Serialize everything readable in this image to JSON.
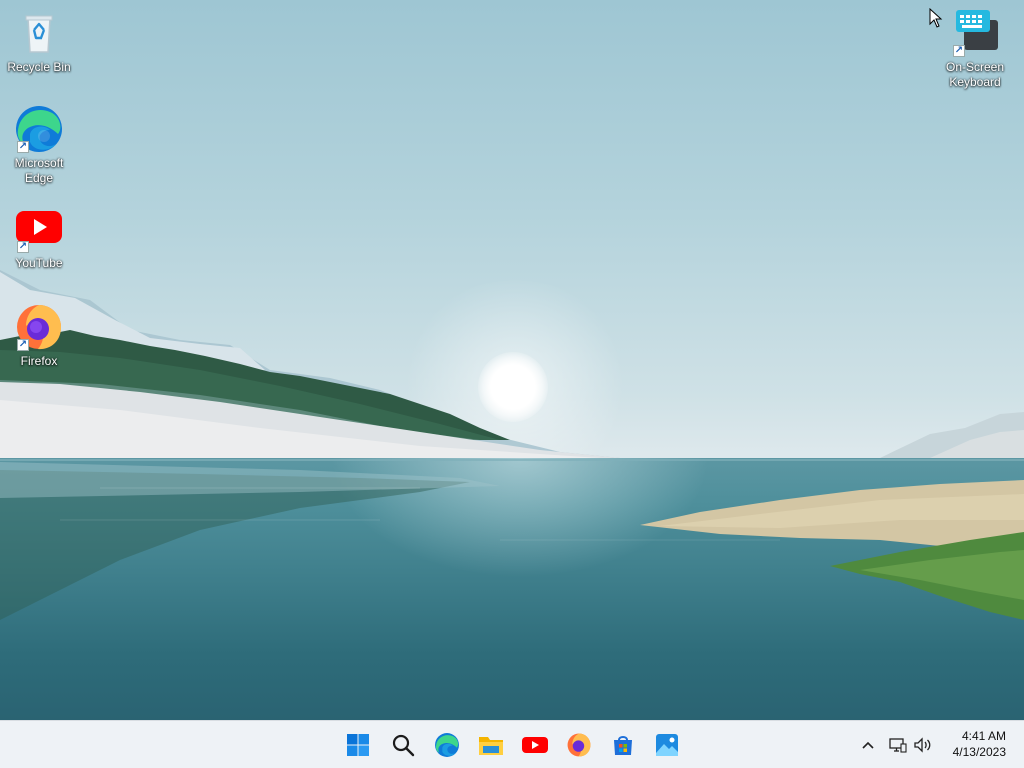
{
  "desktop": {
    "icons": [
      {
        "label": "Recycle Bin"
      },
      {
        "label": "Microsoft Edge"
      },
      {
        "label": "YouTube"
      },
      {
        "label": "Firefox"
      },
      {
        "label": "On-Screen Keyboard"
      }
    ]
  },
  "taskbar": {
    "items": [
      "start-icon",
      "search-icon",
      "edge-icon",
      "file-explorer-icon",
      "youtube-icon",
      "firefox-icon",
      "microsoft-store-icon",
      "photos-icon"
    ],
    "tray": [
      "chevron-up-icon",
      "network-icon",
      "volume-icon"
    ]
  },
  "clock": {
    "time": "4:41 AM",
    "date": "4/13/2023"
  },
  "colors": {
    "taskbar_bg": "#eef2f6",
    "start_blue": "#0a74d8",
    "youtube_red": "#ff0000"
  }
}
